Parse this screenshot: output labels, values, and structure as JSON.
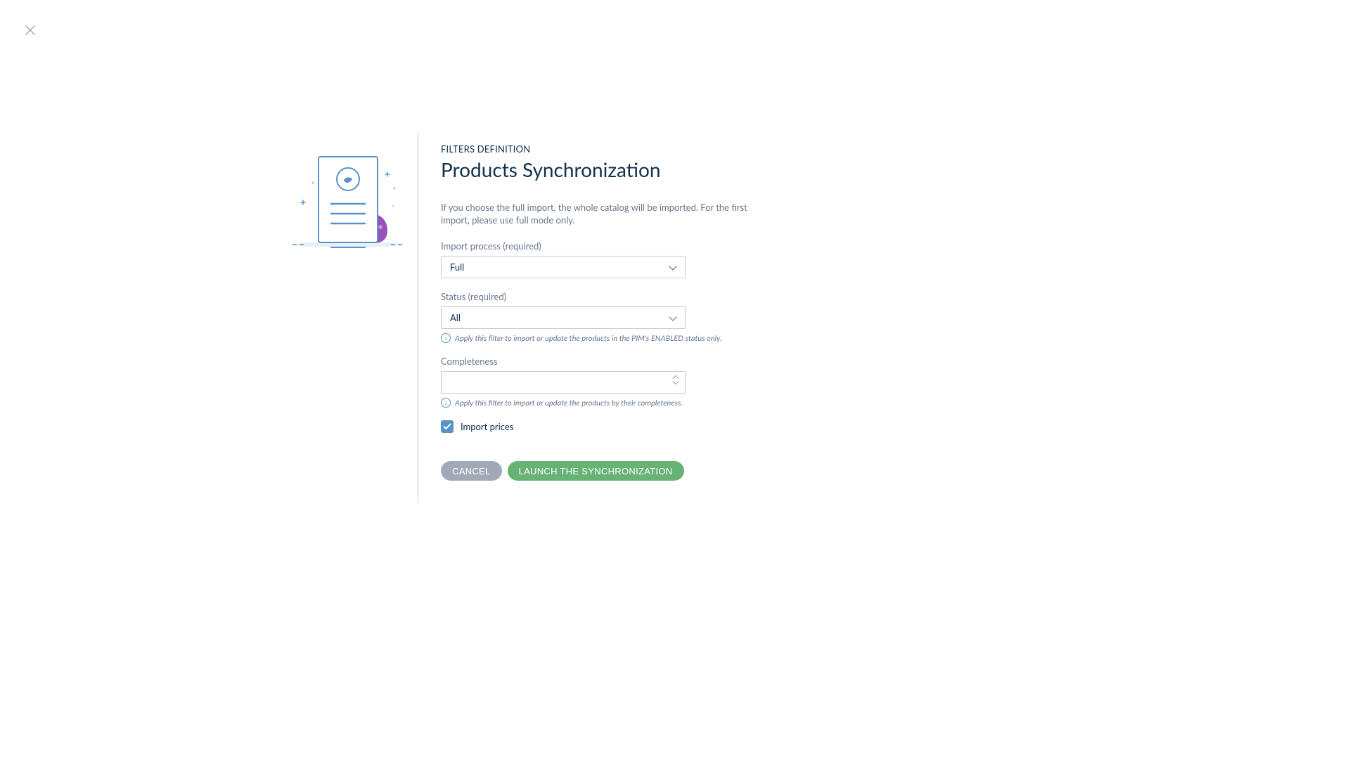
{
  "subtitle": "FILTERS DEFINITION",
  "title": "Products Synchronization",
  "description": "If you choose the full import, the whole catalog will be imported. For the first import, please use full mode only.",
  "fields": {
    "importProcess": {
      "label": "Import process (required)",
      "value": "Full"
    },
    "status": {
      "label": "Status (required)",
      "value": "All",
      "helpText": "Apply this filter to import or update the products in the PIM's ENABLED status only."
    },
    "completeness": {
      "label": "Completeness",
      "value": "",
      "helpText": "Apply this filter to import or update the products by their completeness."
    },
    "importPrices": {
      "label": "Import prices",
      "checked": true
    }
  },
  "buttons": {
    "cancel": "Cancel",
    "launch": "Launch the synchronization"
  }
}
